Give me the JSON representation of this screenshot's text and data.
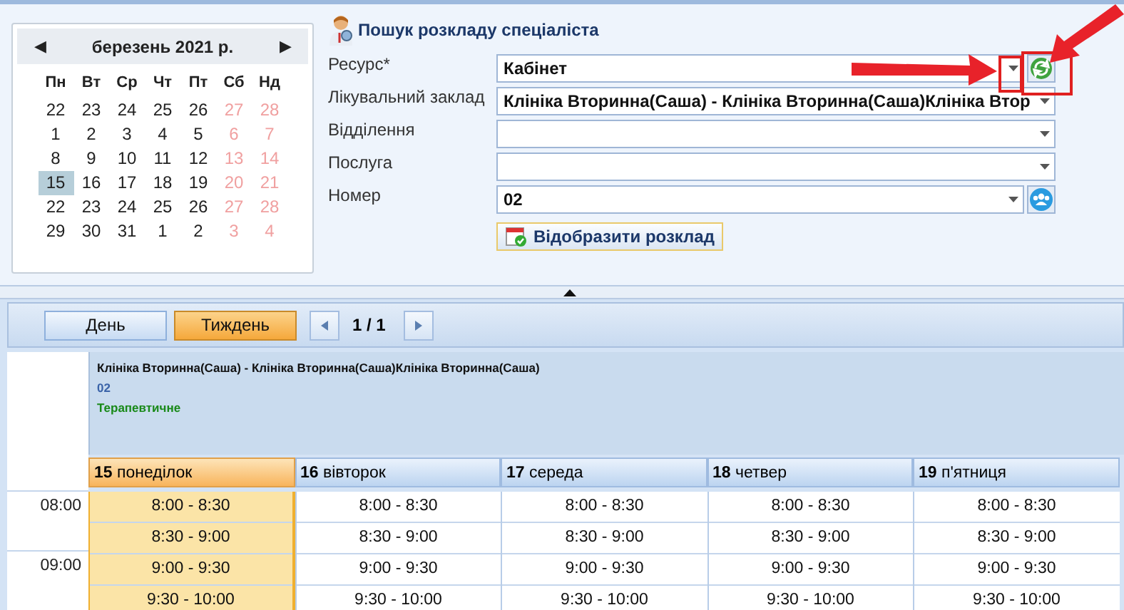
{
  "calendar": {
    "month_title": "березень 2021 р.",
    "prev": "◀",
    "next": "▶",
    "weekdays": [
      "Пн",
      "Вт",
      "Ср",
      "Чт",
      "Пт",
      "Сб",
      "Нд"
    ],
    "weeks": [
      [
        {
          "d": "22",
          "weekend": false,
          "selected": false
        },
        {
          "d": "23",
          "weekend": false,
          "selected": false
        },
        {
          "d": "24",
          "weekend": false,
          "selected": false
        },
        {
          "d": "25",
          "weekend": false,
          "selected": false
        },
        {
          "d": "26",
          "weekend": false,
          "selected": false
        },
        {
          "d": "27",
          "weekend": true,
          "selected": false
        },
        {
          "d": "28",
          "weekend": true,
          "selected": false
        }
      ],
      [
        {
          "d": "1",
          "weekend": false,
          "selected": false
        },
        {
          "d": "2",
          "weekend": false,
          "selected": false
        },
        {
          "d": "3",
          "weekend": false,
          "selected": false
        },
        {
          "d": "4",
          "weekend": false,
          "selected": false
        },
        {
          "d": "5",
          "weekend": false,
          "selected": false
        },
        {
          "d": "6",
          "weekend": true,
          "selected": false
        },
        {
          "d": "7",
          "weekend": true,
          "selected": false
        }
      ],
      [
        {
          "d": "8",
          "weekend": false,
          "selected": false
        },
        {
          "d": "9",
          "weekend": false,
          "selected": false
        },
        {
          "d": "10",
          "weekend": false,
          "selected": false
        },
        {
          "d": "11",
          "weekend": false,
          "selected": false
        },
        {
          "d": "12",
          "weekend": false,
          "selected": false
        },
        {
          "d": "13",
          "weekend": true,
          "selected": false
        },
        {
          "d": "14",
          "weekend": true,
          "selected": false
        }
      ],
      [
        {
          "d": "15",
          "weekend": false,
          "selected": true
        },
        {
          "d": "16",
          "weekend": false,
          "selected": false
        },
        {
          "d": "17",
          "weekend": false,
          "selected": false
        },
        {
          "d": "18",
          "weekend": false,
          "selected": false
        },
        {
          "d": "19",
          "weekend": false,
          "selected": false
        },
        {
          "d": "20",
          "weekend": true,
          "selected": false
        },
        {
          "d": "21",
          "weekend": true,
          "selected": false
        }
      ],
      [
        {
          "d": "22",
          "weekend": false,
          "selected": false
        },
        {
          "d": "23",
          "weekend": false,
          "selected": false
        },
        {
          "d": "24",
          "weekend": false,
          "selected": false
        },
        {
          "d": "25",
          "weekend": false,
          "selected": false
        },
        {
          "d": "26",
          "weekend": false,
          "selected": false
        },
        {
          "d": "27",
          "weekend": true,
          "selected": false
        },
        {
          "d": "28",
          "weekend": true,
          "selected": false
        }
      ],
      [
        {
          "d": "29",
          "weekend": false,
          "selected": false
        },
        {
          "d": "30",
          "weekend": false,
          "selected": false
        },
        {
          "d": "31",
          "weekend": false,
          "selected": false
        },
        {
          "d": "1",
          "weekend": false,
          "selected": false
        },
        {
          "d": "2",
          "weekend": false,
          "selected": false
        },
        {
          "d": "3",
          "weekend": true,
          "selected": false
        },
        {
          "d": "4",
          "weekend": true,
          "selected": false
        }
      ]
    ]
  },
  "search_form": {
    "title": "Пошук розкладу спеціаліста",
    "fields": [
      {
        "label": "Ресурс*",
        "value": "Кабінет",
        "kind": "combo_refresh"
      },
      {
        "label": "Лікувальний заклад",
        "value": "Клініка Вторинна(Саша) - Клініка Вторинна(Саша)Клініка Втор",
        "kind": "combo"
      },
      {
        "label": "Відділення",
        "kind": "combo"
      },
      {
        "label": "Послуга",
        "kind": "combo"
      },
      {
        "label": "Номер",
        "value": "02",
        "kind": "combo_people"
      }
    ],
    "show_button": "Відобразити розклад"
  },
  "toolbar": {
    "views": [
      {
        "label": "День",
        "selected": false
      },
      {
        "label": "Тиждень",
        "selected": true
      }
    ],
    "pager": "1 / 1"
  },
  "resource": [
    {
      "kind": "clinic",
      "text": "Клініка Вторинна(Саша) - Клініка Вторинна(Саша)Клініка Вторинна(Саша)"
    },
    {
      "kind": "number",
      "text": "02"
    },
    {
      "kind": "department",
      "text": "Терапевтичне"
    }
  ],
  "hours": [
    "08:00",
    "09:00"
  ],
  "days": [
    {
      "num": "15",
      "name": "понеділок",
      "selected": true,
      "slots": [
        "8:00 - 8:30",
        "8:30 - 9:00",
        "9:00 - 9:30",
        "9:30 - 10:00"
      ]
    },
    {
      "num": "16",
      "name": "вівторок",
      "selected": false,
      "slots": [
        "8:00 - 8:30",
        "8:30 - 9:00",
        "9:00 - 9:30",
        "9:30 - 10:00"
      ]
    },
    {
      "num": "17",
      "name": "середа",
      "selected": false,
      "slots": [
        "8:00 - 8:30",
        "8:30 - 9:00",
        "9:00 - 9:30",
        "9:30 - 10:00"
      ]
    },
    {
      "num": "18",
      "name": "четвер",
      "selected": false,
      "slots": [
        "8:00 - 8:30",
        "8:30 - 9:00",
        "9:00 - 9:30",
        "9:30 - 10:00"
      ]
    },
    {
      "num": "19",
      "name": "п'ятниця",
      "selected": false,
      "slots": [
        "8:00 - 8:30",
        "8:30 - 9:00",
        "9:00 - 9:30",
        "9:30 - 10:00"
      ]
    }
  ]
}
